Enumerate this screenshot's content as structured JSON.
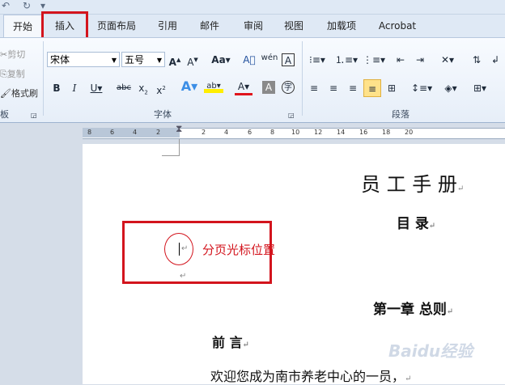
{
  "tabs": [
    {
      "label": "开始",
      "active": true
    },
    {
      "label": "插入",
      "active": false
    },
    {
      "label": "页面布局",
      "active": false
    },
    {
      "label": "引用",
      "active": false
    },
    {
      "label": "邮件",
      "active": false
    },
    {
      "label": "审阅",
      "active": false
    },
    {
      "label": "视图",
      "active": false
    },
    {
      "label": "加载项",
      "active": false
    },
    {
      "label": "Acrobat",
      "active": false
    }
  ],
  "clipboard": {
    "cut": "剪切",
    "copy": "复制",
    "format_painter": "格式刷"
  },
  "font": {
    "name": "宋体",
    "size": "五号",
    "group_label": "字体"
  },
  "paragraph": {
    "group_label": "段落"
  },
  "ruler": [
    "8",
    "6",
    "4",
    "2",
    "2",
    "4",
    "6",
    "8",
    "10",
    "12",
    "14",
    "16",
    "18",
    "20"
  ],
  "document": {
    "title": "员 工 手 册",
    "toc": "目  录",
    "annotation": "分页光标位置",
    "chapter": "第一章  总则",
    "preface": "前  言",
    "body": "欢迎您成为南市养老中心的一员，"
  },
  "watermark": "Baidu经验",
  "colors": {
    "highlight_red": "#d3141d",
    "annotation_red": "#d3141d"
  }
}
